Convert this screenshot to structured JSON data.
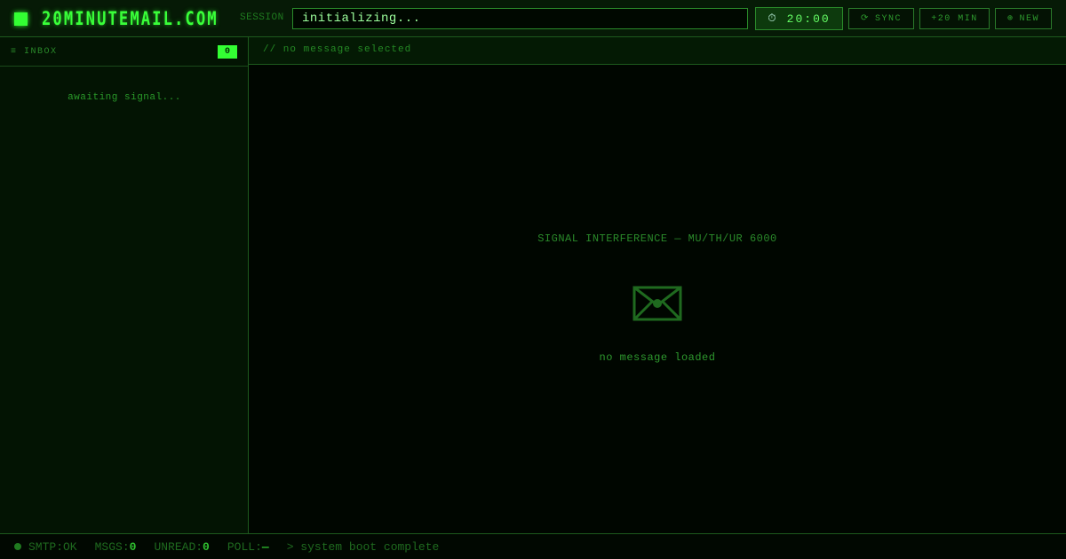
{
  "header": {
    "brand": "20MINUTEMAIL.COM",
    "session_label": "SESSION",
    "session_value": "initializing...",
    "timer_icon": "stopwatch-icon",
    "timer_glyph": "⏱",
    "timer_value": "20:00",
    "sync_glyph": "⟳",
    "sync_label": "SYNC",
    "extend_label": "+20 MIN",
    "new_glyph": "⊕",
    "new_label": "NEW"
  },
  "sidebar": {
    "inbox_glyph": "≡",
    "inbox_label": "INBOX",
    "inbox_count": "0",
    "empty_text": "awaiting signal..."
  },
  "main": {
    "header_text": "// no message selected",
    "interference_text": "SIGNAL INTERFERENCE — MU/TH/UR 6000",
    "placeholder_icon": "envelope-icon",
    "empty_text": "no message loaded"
  },
  "statusbar": {
    "smtp_label": "SMTP:OK",
    "msgs_label": "MSGS:",
    "msgs_value": "0",
    "unread_label": "UNREAD:",
    "unread_value": "0",
    "poll_label": "POLL:",
    "poll_value": "—",
    "message": "> system boot complete"
  },
  "colors": {
    "accent": "#33ff33",
    "background": "#020a02",
    "panel": "#031403",
    "border": "#1d5a1d",
    "dim_text": "#2a8a2a"
  }
}
